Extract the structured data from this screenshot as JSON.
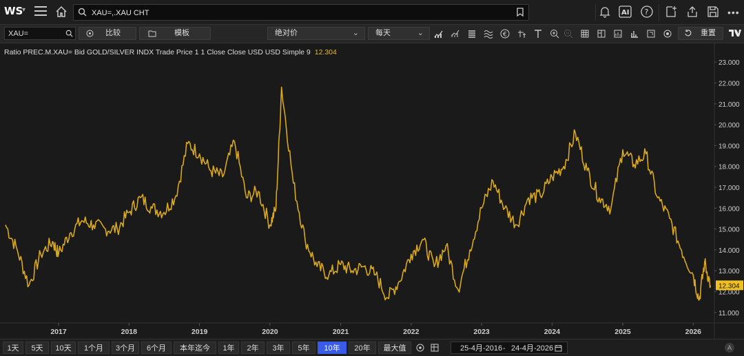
{
  "app": {
    "logo": "WS",
    "search_value": "XAU=,.XAU CHT"
  },
  "toolbar": {
    "ric_value": "XAU=",
    "compare_label": "比较",
    "template_label": "模板",
    "price_type": "绝对价",
    "interval": "每天",
    "reset_label": "重置"
  },
  "legend": {
    "text": "Ratio PREC.M.XAU= Bid GOLD/SILVER INDX Trade Price 1 1 Close Close USD USD Simple 9",
    "last_value": "12.304"
  },
  "colors": {
    "line": "#d9a81c",
    "last_label_bg": "#f0c020",
    "active_range": "#3a5be8"
  },
  "ranges": [
    {
      "label": "1天"
    },
    {
      "label": "5天"
    },
    {
      "label": "10天"
    },
    {
      "label": "1个月"
    },
    {
      "label": "3个月"
    },
    {
      "label": "6个月"
    },
    {
      "label": "本年迄今"
    },
    {
      "label": "1年"
    },
    {
      "label": "2年"
    },
    {
      "label": "3年"
    },
    {
      "label": "5年"
    },
    {
      "label": "10年"
    },
    {
      "label": "20年"
    },
    {
      "label": "最大值"
    }
  ],
  "active_range": "10年",
  "date_range": {
    "start": "25-4月-2016",
    "separator": "-",
    "end": "24-4月-2026"
  },
  "chart_data": {
    "type": "line",
    "series": [
      {
        "points": [
          [
            "2016-04",
            15.2
          ],
          [
            "2016-06",
            14.0
          ],
          [
            "2016-08",
            12.3
          ],
          [
            "2016-10",
            13.8
          ],
          [
            "2016-12",
            14.4
          ],
          [
            "2017-01",
            13.8
          ],
          [
            "2017-03",
            14.8
          ],
          [
            "2017-05",
            15.4
          ],
          [
            "2017-07",
            15.2
          ],
          [
            "2017-09",
            15.0
          ],
          [
            "2017-11",
            15.0
          ],
          [
            "2018-01",
            15.8
          ],
          [
            "2018-03",
            16.5
          ],
          [
            "2018-05",
            16.0
          ],
          [
            "2018-07",
            15.8
          ],
          [
            "2018-09",
            16.6
          ],
          [
            "2018-11",
            19.1
          ],
          [
            "2019-01",
            18.6
          ],
          [
            "2019-03",
            17.8
          ],
          [
            "2019-05",
            17.5
          ],
          [
            "2019-07",
            19.2
          ],
          [
            "2019-09",
            16.5
          ],
          [
            "2019-11",
            16.8
          ],
          [
            "2020-01",
            15.2
          ],
          [
            "2020-02",
            16.0
          ],
          [
            "2020-03",
            21.8
          ],
          [
            "2020-05",
            17.2
          ],
          [
            "2020-07",
            14.5
          ],
          [
            "2020-09",
            13.2
          ],
          [
            "2020-11",
            12.8
          ],
          [
            "2021-01",
            13.3
          ],
          [
            "2021-03",
            13.0
          ],
          [
            "2021-05",
            13.2
          ],
          [
            "2021-07",
            12.8
          ],
          [
            "2021-09",
            11.7
          ],
          [
            "2021-11",
            12.5
          ],
          [
            "2022-01",
            13.8
          ],
          [
            "2022-03",
            14.5
          ],
          [
            "2022-05",
            13.2
          ],
          [
            "2022-07",
            14.2
          ],
          [
            "2022-09",
            12.1
          ],
          [
            "2022-11",
            14.0
          ],
          [
            "2023-01",
            16.0
          ],
          [
            "2023-03",
            17.3
          ],
          [
            "2023-05",
            16.0
          ],
          [
            "2023-07",
            15.2
          ],
          [
            "2023-09",
            16.5
          ],
          [
            "2023-11",
            16.6
          ],
          [
            "2024-01",
            17.5
          ],
          [
            "2024-03",
            18.0
          ],
          [
            "2024-05",
            19.6
          ],
          [
            "2024-07",
            17.8
          ],
          [
            "2024-09",
            16.5
          ],
          [
            "2024-11",
            16.0
          ],
          [
            "2025-01",
            18.8
          ],
          [
            "2025-03",
            18.1
          ],
          [
            "2025-05",
            18.6
          ],
          [
            "2025-07",
            16.5
          ],
          [
            "2025-09",
            15.5
          ],
          [
            "2025-11",
            14.0
          ],
          [
            "2026-01",
            12.8
          ],
          [
            "2026-02",
            11.6
          ],
          [
            "2026-03",
            13.4
          ],
          [
            "2026-04",
            12.3
          ]
        ]
      }
    ],
    "x_ticks": [
      "2017",
      "2018",
      "2019",
      "2020",
      "2021",
      "2022",
      "2023",
      "2024",
      "2025",
      "2026"
    ],
    "y_ticks": [
      "11.000",
      "12.000",
      "13.000",
      "14.000",
      "15.000",
      "16.000",
      "17.000",
      "18.000",
      "19.000",
      "20.000",
      "21.000",
      "22.000",
      "23.000"
    ],
    "ylim": [
      10.5,
      23.5
    ],
    "last_value": "12.304",
    "grid": false
  }
}
